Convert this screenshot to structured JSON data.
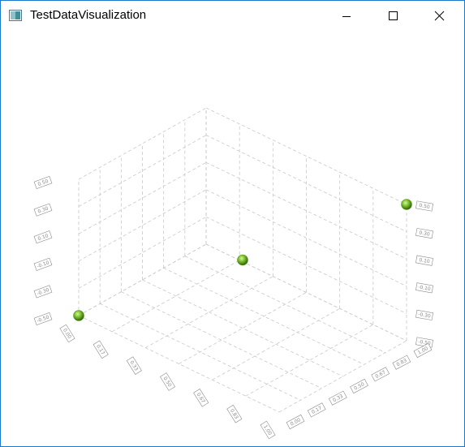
{
  "window": {
    "title": "TestDataVisualization"
  },
  "icons": {
    "app": "app-window-icon",
    "minimize": "minimize-icon",
    "maximize": "maximize-icon",
    "close": "close-icon"
  },
  "colors": {
    "frame_border": "#1979ca",
    "grid": "#c8c8c8",
    "point": "#5a9a1e",
    "label": "#8a8a8a"
  },
  "chart_data": {
    "type": "scatter",
    "series": [
      {
        "points": [
          [
            0,
            0,
            -0.5
          ],
          [
            1,
            1,
            0.5
          ],
          [
            0.5,
            0.5,
            0
          ]
        ]
      }
    ],
    "y_tick_labels": [
      "0.50",
      "0.30",
      "0.10",
      "-0.10",
      "-0.30",
      "-0.50"
    ],
    "x_tick_labels": [
      "0.00",
      "0.17",
      "0.33",
      "0.50",
      "0.67",
      "0.83",
      "1.00"
    ],
    "z_tick_labels": [
      "0.00",
      "0.17",
      "0.33",
      "0.50",
      "0.67",
      "0.83",
      "1.00"
    ],
    "grid": true
  }
}
